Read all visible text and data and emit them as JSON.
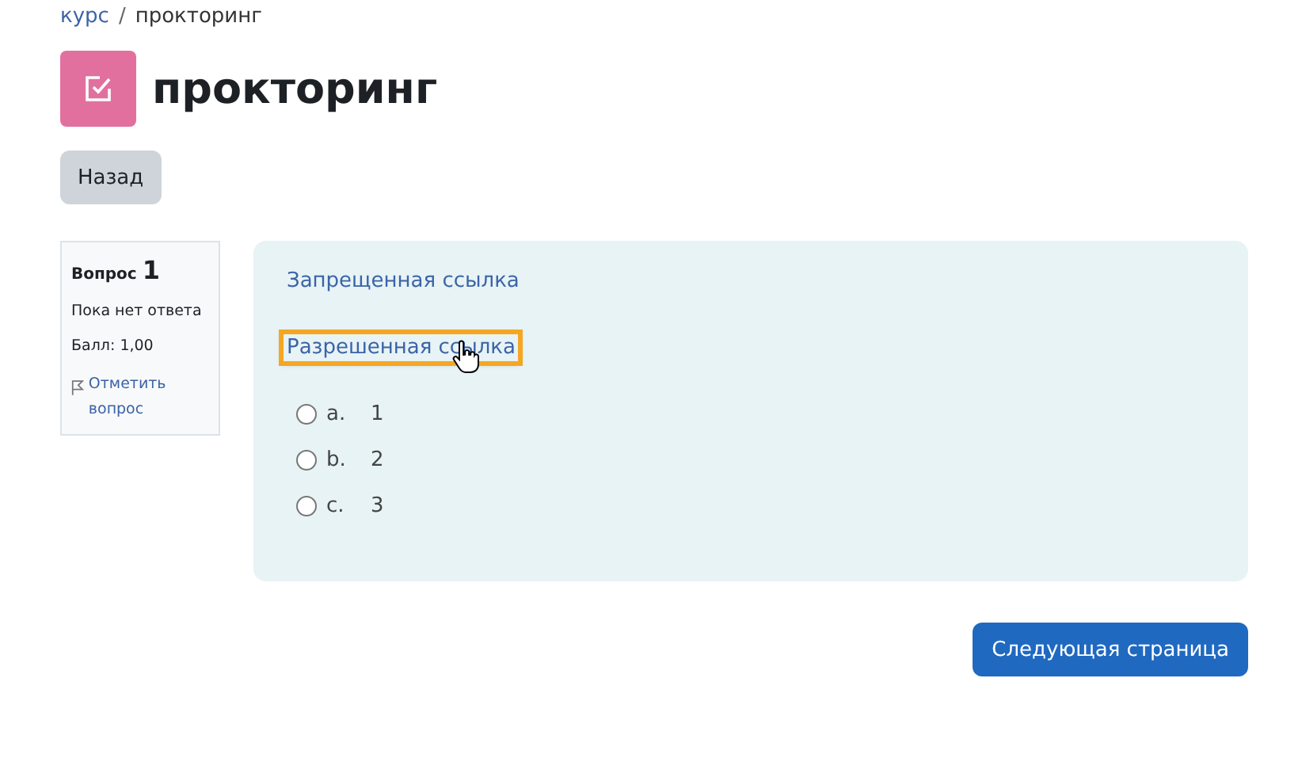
{
  "breadcrumb": [
    {
      "label": "курс",
      "link": true
    },
    {
      "label": "прокторинг",
      "link": false
    }
  ],
  "breadcrumb_separator": "/",
  "title": "прокторинг",
  "back_button": "Назад",
  "question_info": {
    "label": "Вопрос",
    "number": "1",
    "status": "Пока нет ответа",
    "grade": "Балл: 1,00",
    "flag_link": "Отметить вопрос"
  },
  "links": [
    {
      "label": "Запрещенная ссылка",
      "focused": false
    },
    {
      "label": "Разрешенная ссылка",
      "focused": true
    }
  ],
  "options": [
    {
      "letter": "a.",
      "text": "1",
      "selected": false
    },
    {
      "letter": "b.",
      "text": "2",
      "selected": false
    },
    {
      "letter": "c.",
      "text": "3",
      "selected": false
    }
  ],
  "next_button": "Следующая страница"
}
